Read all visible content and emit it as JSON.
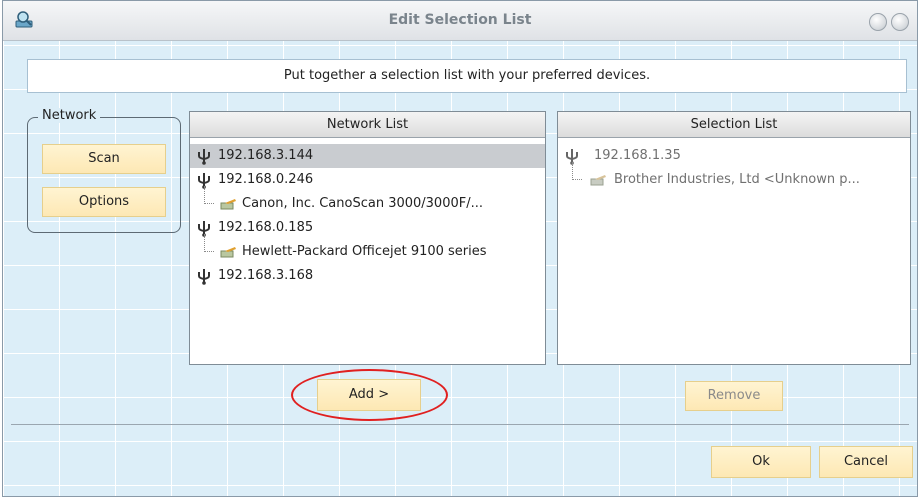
{
  "window": {
    "title": "Edit Selection List"
  },
  "banner": {
    "text": "Put together a selection list with your preferred devices."
  },
  "network_group": {
    "legend": "Network",
    "scan_label": "Scan",
    "options_label": "Options"
  },
  "network_list": {
    "header": "Network List",
    "items": [
      {
        "label": "192.168.3.144",
        "selected": true
      },
      {
        "label": "192.168.0.246",
        "device": "Canon, Inc. CanoScan 3000/3000F/..."
      },
      {
        "label": "192.168.0.185",
        "device": "Hewlett-Packard Officejet 9100 series"
      },
      {
        "label": "192.168.3.168"
      }
    ]
  },
  "selection_list": {
    "header": "Selection List",
    "items": [
      {
        "label": "192.168.1.35",
        "device": "Brother Industries, Ltd <Unknown p..."
      }
    ]
  },
  "buttons": {
    "add_label": "Add >",
    "remove_label": "Remove",
    "ok_label": "Ok",
    "cancel_label": "Cancel"
  },
  "colors": {
    "accent_button": "#fde8b4",
    "highlight_ring": "#e02020",
    "background": "#dceef8"
  },
  "icons": {
    "app": "network-scanner-icon",
    "host": "usb-trident-icon",
    "device": "scanner-device-icon"
  }
}
